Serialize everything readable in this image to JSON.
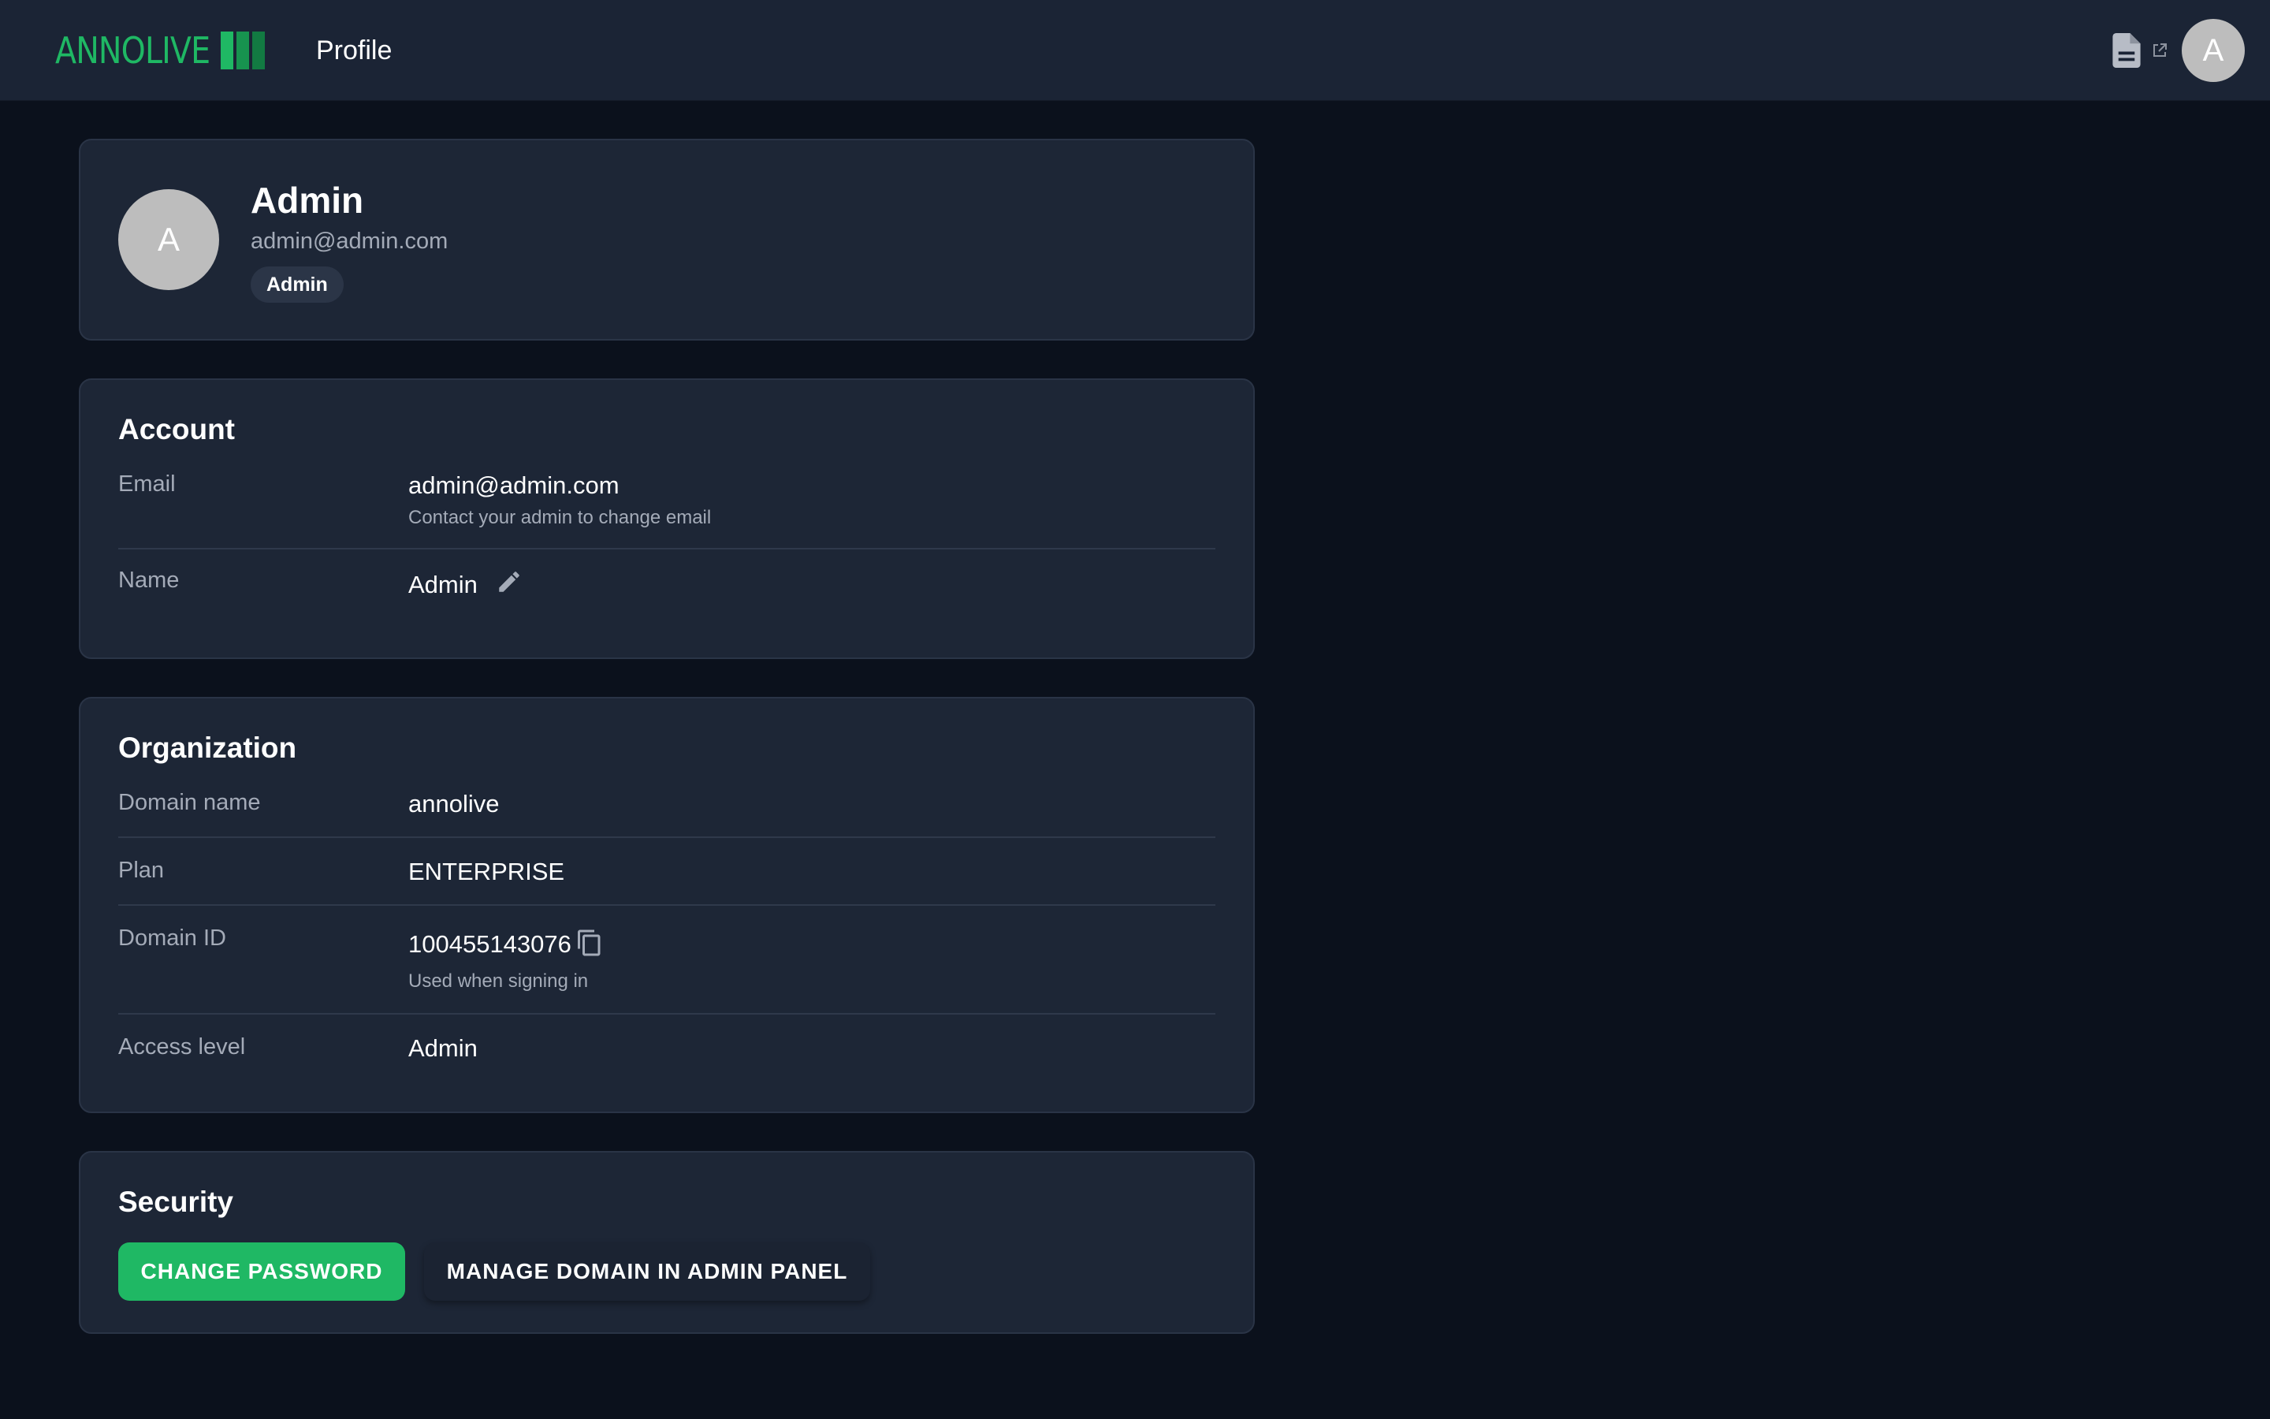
{
  "header": {
    "logo_text": "ANNOLIVE",
    "page_title": "Profile",
    "docs_icon": "document-icon",
    "external_icon": "external-link-icon",
    "avatar_initial": "A"
  },
  "profile": {
    "avatar_initial": "A",
    "name": "Admin",
    "email": "admin@admin.com",
    "role_badge": "Admin"
  },
  "account": {
    "title": "Account",
    "email_label": "Email",
    "email_value": "admin@admin.com",
    "email_hint": "Contact your admin to change email",
    "name_label": "Name",
    "name_value": "Admin",
    "edit_icon": "pencil-icon"
  },
  "organization": {
    "title": "Organization",
    "domain_name_label": "Domain name",
    "domain_name_value": "annolive",
    "plan_label": "Plan",
    "plan_value": "ENTERPRISE",
    "domain_id_label": "Domain ID",
    "domain_id_value": "100455143076",
    "domain_id_hint": "Used when signing in",
    "copy_icon": "copy-icon",
    "access_level_label": "Access level",
    "access_level_value": "Admin"
  },
  "security": {
    "title": "Security",
    "change_password_label": "CHANGE PASSWORD",
    "manage_domain_label": "MANAGE DOMAIN IN ADMIN PANEL"
  },
  "colors": {
    "page_background": "#0b111c",
    "topbar_background": "#1b2435",
    "card_background": "#1d2636",
    "accent_green": "#1fb864",
    "muted_text": "#a4abb8",
    "avatar_gray": "#bdbdbd"
  }
}
